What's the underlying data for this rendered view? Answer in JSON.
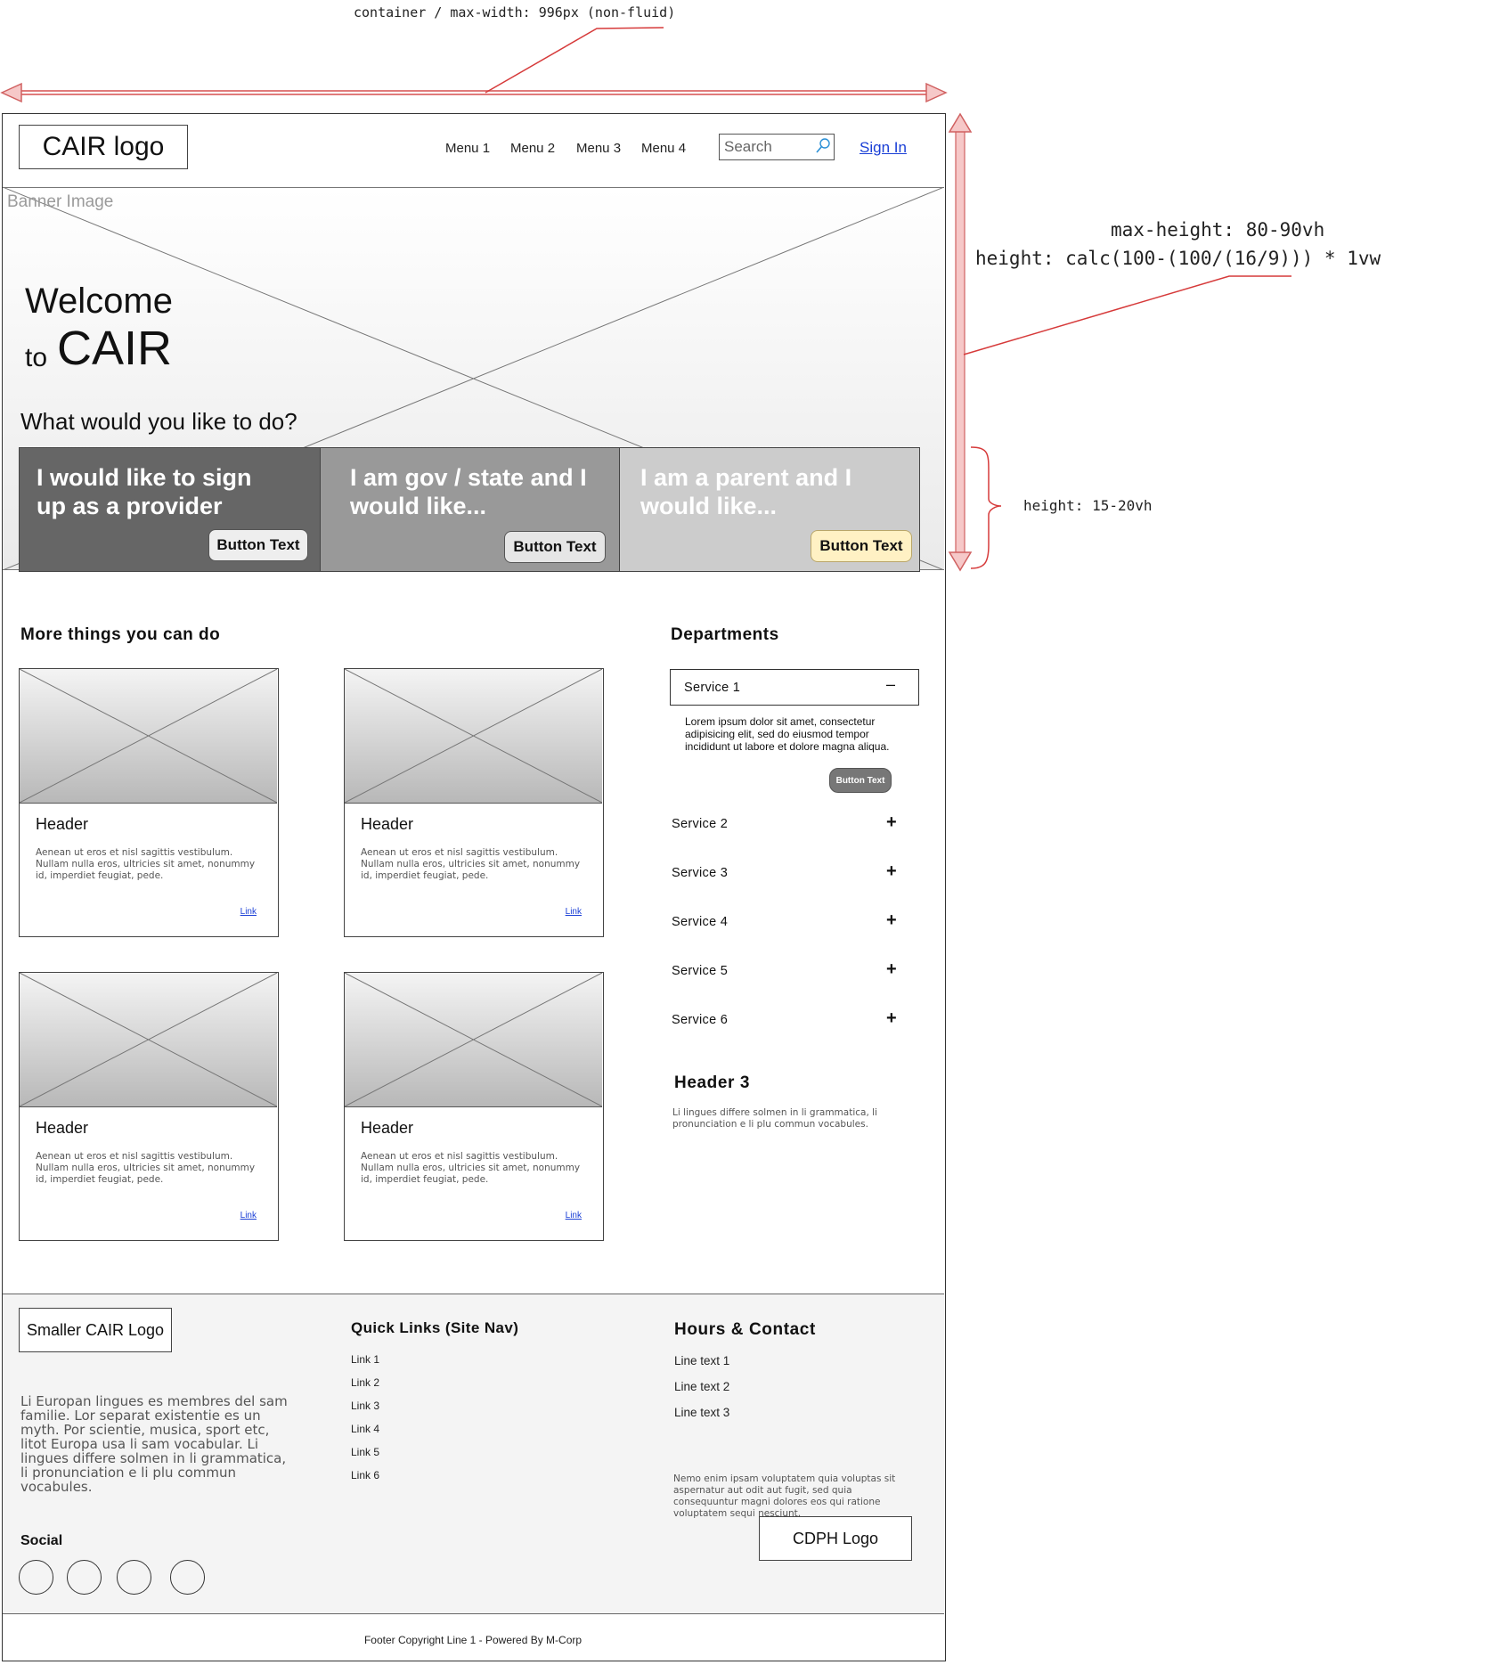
{
  "annotations": {
    "container_note": "container / max-width: 996px (non-fluid)",
    "max_height_note": "max-height: 80-90vh",
    "height_note": "height: calc(100-(100/(16/9))) * 1vw",
    "cards_height_note": "height: 15-20vh"
  },
  "header": {
    "logo": "CAIR logo",
    "menu": [
      "Menu 1",
      "Menu 2",
      "Menu 3",
      "Menu 4"
    ],
    "search_placeholder": "Search",
    "sign_in": "Sign In"
  },
  "banner": {
    "label": "Banner Image",
    "welcome_line1": "Welcome",
    "welcome_to": "to",
    "welcome_cair": "CAIR",
    "question": "What would you like to do?",
    "cards": [
      {
        "text_line1": "I would like to sign",
        "text_line2": "up as a provider",
        "button": "Button Text",
        "bg": "#666666",
        "button_bg": "#eeeeee"
      },
      {
        "text_line1": "I am gov / state and I",
        "text_line2": "would like...",
        "button": "Button Text",
        "bg": "#999999",
        "button_bg": "#e6e6e6"
      },
      {
        "text_line1": "I am a parent and I",
        "text_line2": "would like...",
        "button": "Button Text",
        "bg": "#cccccc",
        "button_bg": "#fff1c4"
      }
    ]
  },
  "more": {
    "title": "More things you can do",
    "tiles": [
      {
        "header": "Header",
        "body": "Aenean ut eros et nisl sagittis vestibulum. Nullam nulla eros, ultricies sit amet, nonummy id, imperdiet feugiat, pede.",
        "link": "Link"
      },
      {
        "header": "Header",
        "body": "Aenean ut eros et nisl sagittis vestibulum. Nullam nulla eros, ultricies sit amet, nonummy id, imperdiet feugiat, pede.",
        "link": "Link"
      },
      {
        "header": "Header",
        "body": "Aenean ut eros et nisl sagittis vestibulum. Nullam nulla eros, ultricies sit amet, nonummy id, imperdiet feugiat, pede.",
        "link": "Link"
      },
      {
        "header": "Header",
        "body": "Aenean ut eros et nisl sagittis vestibulum. Nullam nulla eros, ultricies sit amet, nonummy id, imperdiet feugiat, pede.",
        "link": "Link"
      }
    ]
  },
  "departments": {
    "title": "Departments",
    "services": [
      {
        "label": "Service 1",
        "toggle": "–",
        "expanded": true
      },
      {
        "label": "Service 2",
        "toggle": "+"
      },
      {
        "label": "Service 3",
        "toggle": "+"
      },
      {
        "label": "Service 4",
        "toggle": "+"
      },
      {
        "label": "Service 5",
        "toggle": "+"
      },
      {
        "label": "Service 6",
        "toggle": "+"
      }
    ],
    "service1_body": "Lorem ipsum dolor sit amet, consectetur adipisicing elit, sed do eiusmod tempor incididunt ut labore et dolore magna aliqua.",
    "service1_button": "Button Text",
    "header3": "Header 3",
    "header3_text": "Li lingues differe solmen in li grammatica, li pronunciation e li plu commun vocabules."
  },
  "footer": {
    "small_logo": "Smaller CAIR Logo",
    "about": "Li Europan lingues es membres del sam familie. Lor separat existentie es un myth. Por scientie, musica, sport etc, litot Europa usa li sam vocabular. Li lingues differe solmen in li grammatica, li pronunciation e li plu commun vocabules.",
    "quick_title": "Quick Links (Site Nav)",
    "quick_links": [
      "Link 1",
      "Link 2",
      "Link 3",
      "Link 4",
      "Link 5",
      "Link 6"
    ],
    "hours_title": "Hours & Contact",
    "lines": [
      "Line text 1",
      "Line text 2",
      "Line text 3"
    ],
    "contact_text": "Nemo enim ipsam voluptatem quia voluptas sit aspernatur aut odit aut fugit, sed quia consequuntur magni dolores eos qui ratione voluptatem sequi nesciunt.",
    "cdph_logo": "CDPH Logo",
    "social_title": "Social",
    "copyright": "Footer Copyright Line 1 - Powered By M-Corp"
  }
}
